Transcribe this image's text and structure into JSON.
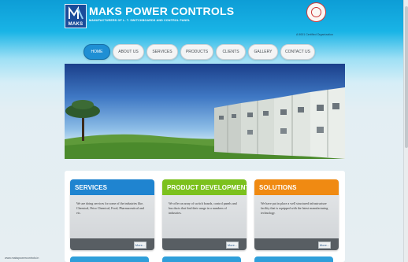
{
  "header": {
    "brand_title": "MAKS POWER CONTROLS",
    "brand_subtitle": "MANUFACTURERS OF L. T. SWITCHBOARDS AND CONTROL PANEL",
    "logo_text": "MAKS",
    "certification": "A 9001 Certified Organization"
  },
  "nav": {
    "items": [
      {
        "label": "HOME",
        "active": true
      },
      {
        "label": "ABOUT US",
        "active": false
      },
      {
        "label": "SERVICES",
        "active": false
      },
      {
        "label": "PRODUCTS",
        "active": false
      },
      {
        "label": "CLIENTS",
        "active": false
      },
      {
        "label": "GALLERY",
        "active": false
      },
      {
        "label": "CONTACT US",
        "active": false
      }
    ]
  },
  "cards": [
    {
      "title": "SERVICES",
      "color": "#1f84d0",
      "text": "We are doing services for some of the industries like, Chemical, Petro Chemical, Food, Pharmaceutical and etc.",
      "button": "More..."
    },
    {
      "title": "PRODUCT DEVELOPMENT",
      "color": "#7cc11d",
      "text": "We offer an array of switch boards, control panels and bus ducts that find their usage in a numbers of industries.",
      "button": "More..."
    },
    {
      "title": "SOLUTIONS",
      "color": "#f08a12",
      "text": "We have put in place a well structured infrastructure facility that is equipped with the latest manufacturing technology.",
      "button": "More..."
    }
  ],
  "status_bar": {
    "url": "www.makspowercontrols.in"
  },
  "colors": {
    "header_blue": "#0d9dd6",
    "nav_active": "#1f8fd4"
  }
}
